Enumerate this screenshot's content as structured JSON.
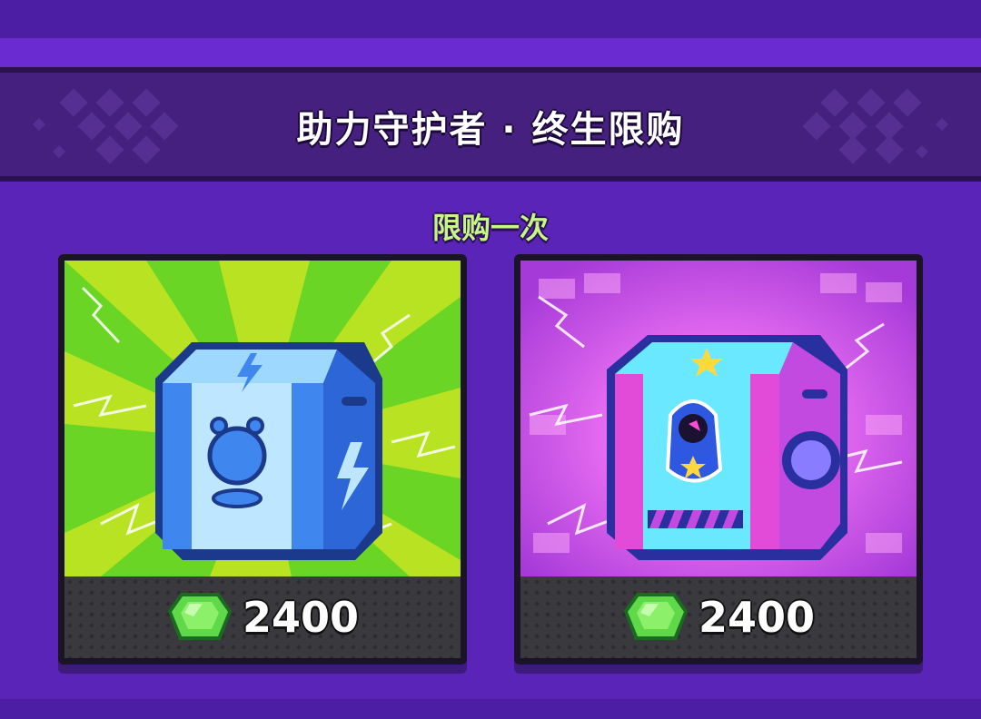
{
  "header": {
    "title": "助力守护者 · 终生限购"
  },
  "section": {
    "subtitle": "限购一次"
  },
  "offers": [
    {
      "art_icon": "blue-lightning-box",
      "currency_icon": "green-gem-icon",
      "price": "2400"
    },
    {
      "art_icon": "pink-star-box",
      "currency_icon": "green-gem-icon",
      "price": "2400"
    }
  ],
  "colors": {
    "background": "#5a24b8",
    "banner": "#45207e",
    "subtitle_text": "#c7f58a",
    "price_bar": "#3a3a3e",
    "gem": "#5fd84a"
  }
}
